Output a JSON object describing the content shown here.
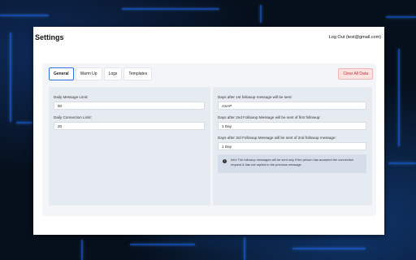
{
  "header": {
    "title": "Settings",
    "logout": "Log Out (test@gmail.com)"
  },
  "tabs": [
    "General",
    "Warm Up",
    "Logs",
    "Templates"
  ],
  "clear_button": "Clear All Data",
  "left": {
    "daily_message_label": "Daily Message Limit:",
    "daily_message_value": "80",
    "daily_connection_label": "Daily Connection Limit:",
    "daily_connection_value": "20"
  },
  "right": {
    "followup1_label": "Days after 1st followup message will be sent:",
    "followup1_value": "ASAP",
    "followup2_label": "Days after 2nd Followup Message will be sent of first followup:",
    "followup2_value": "1 Day",
    "followup3_label": "Days after 3rd Followup Message will be sent of 2nd followup message:",
    "followup3_value": "1 Day",
    "note": "Info! The followup messages will be sent only if the person has accepted the connection request & has not replied to the previous message."
  },
  "colors": {
    "accent": "#2f6fe0",
    "danger": "#c53030",
    "danger_bg": "#fde2e2"
  }
}
